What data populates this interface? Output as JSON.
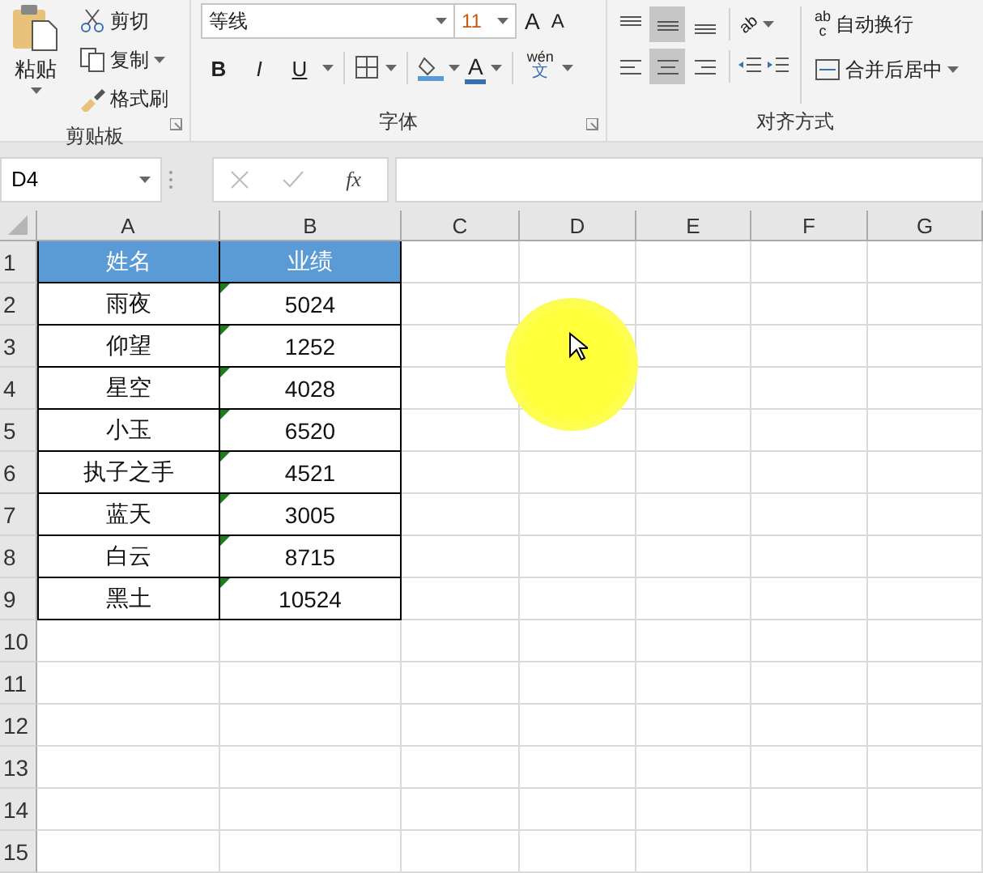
{
  "ribbon": {
    "clipboard": {
      "paste": "粘贴",
      "cut": "剪切",
      "copy": "复制",
      "format_painter": "格式刷",
      "title": "剪贴板"
    },
    "font": {
      "font_name": "等线",
      "font_size": "11",
      "grow": "A",
      "shrink": "A",
      "bold": "B",
      "italic": "I",
      "underline": "U",
      "font_color": "A",
      "phonetic_top": "wén",
      "phonetic_bottom": "文",
      "title": "字体"
    },
    "alignment": {
      "vertical": [
        {
          "selected": false
        },
        {
          "selected": true
        },
        {
          "selected": false
        }
      ],
      "horizontal": [
        {
          "selected": false
        },
        {
          "selected": true
        },
        {
          "selected": false
        }
      ],
      "orientation": "ab",
      "wrap_top": "ab",
      "wrap_bottom": "c",
      "wrap_text": "自动换行",
      "merge_center": "合并后居中",
      "title": "对齐方式"
    }
  },
  "formula_bar": {
    "name_box": "D4",
    "fx": "fx"
  },
  "sheet": {
    "columns": [
      "A",
      "B",
      "C",
      "D",
      "E",
      "F",
      "G"
    ],
    "row_numbers": [
      "1",
      "2",
      "3",
      "4",
      "5",
      "6",
      "7",
      "8",
      "9",
      "10",
      "11",
      "12",
      "13",
      "14",
      "15"
    ],
    "header": [
      "姓名",
      "业绩"
    ],
    "rows": [
      {
        "name": "雨夜",
        "score": "5024",
        "flag": true
      },
      {
        "name": "仰望",
        "score": "1252",
        "flag": true
      },
      {
        "name": "星空",
        "score": "4028",
        "flag": true
      },
      {
        "name": "小玉",
        "score": "6520",
        "flag": true
      },
      {
        "name": "执子之手",
        "score": "4521",
        "flag": true
      },
      {
        "name": "蓝天",
        "score": "3005",
        "flag": true
      },
      {
        "name": "白云",
        "score": "8715",
        "flag": true
      },
      {
        "name": "黑土",
        "score": "10524",
        "flag": true
      }
    ]
  }
}
